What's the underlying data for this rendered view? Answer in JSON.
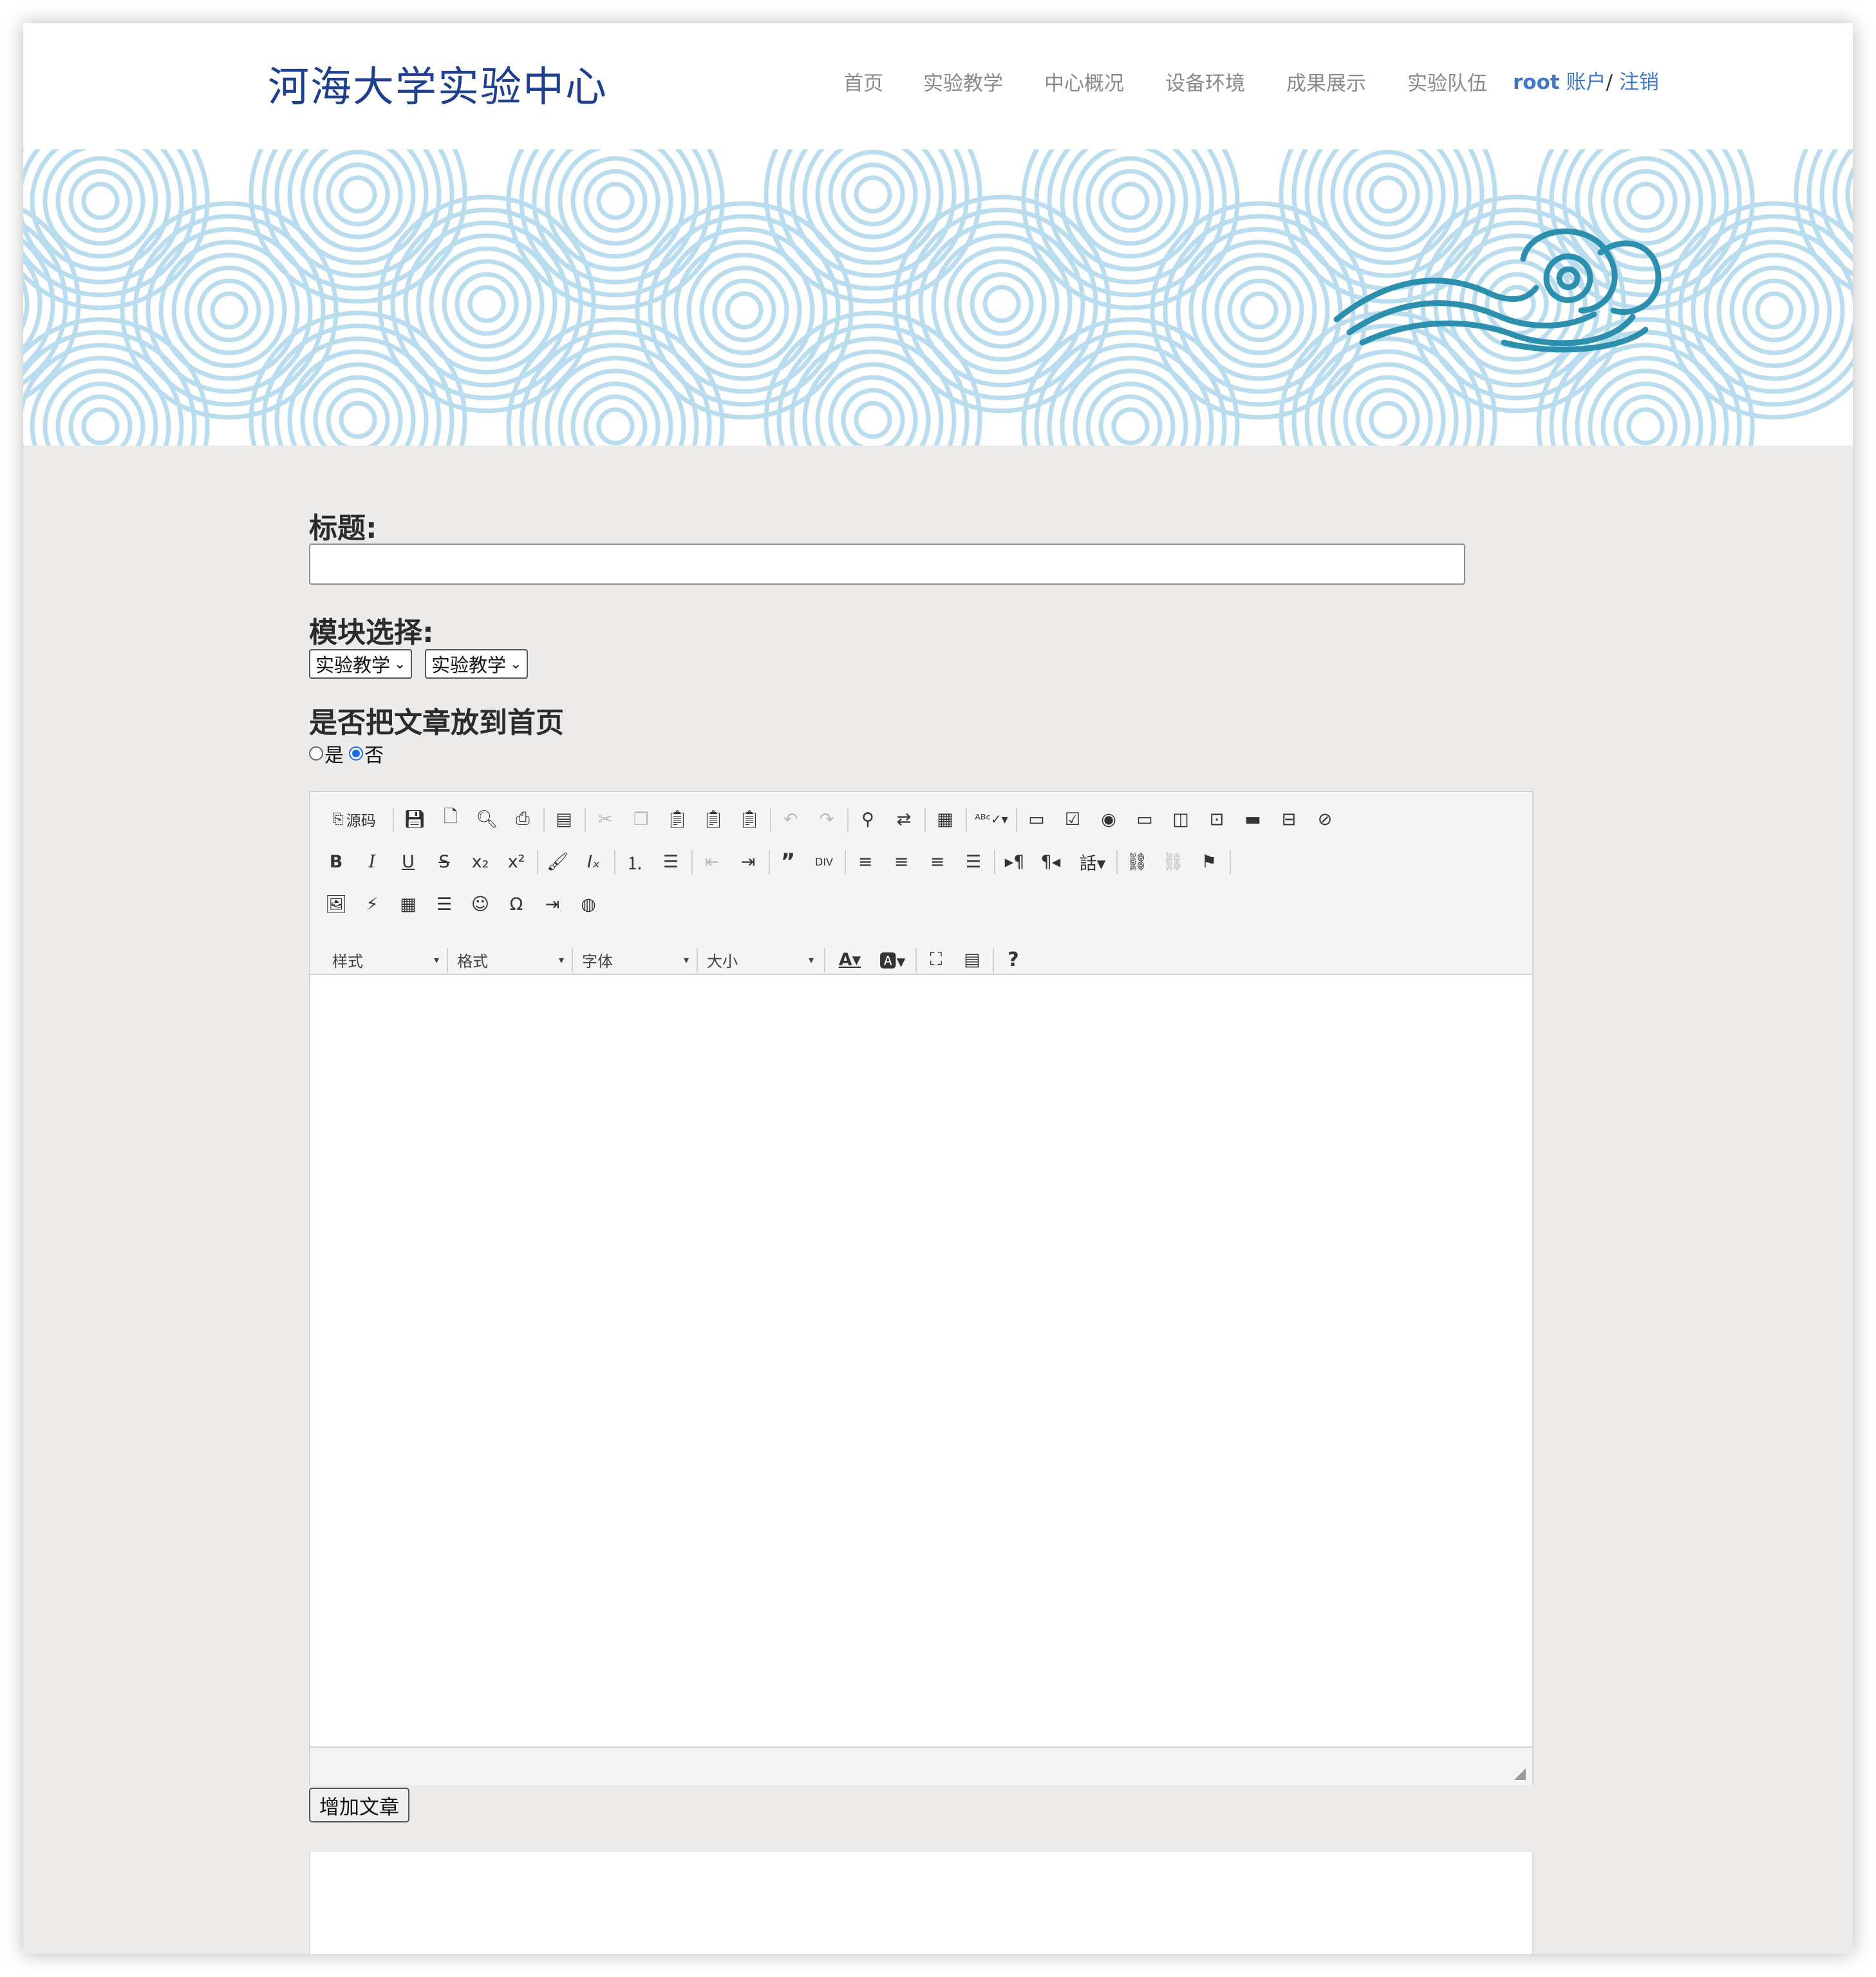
{
  "header": {
    "site_title": "河海大学实验中心",
    "nav": [
      "首页",
      "实验教学",
      "中心概况",
      "设备环境",
      "成果展示",
      "实验队伍"
    ],
    "account_user": "root",
    "account_label": "账户",
    "account_sep": "/",
    "logout_label": "注销"
  },
  "form": {
    "title_label": "标题:",
    "title_value": "",
    "module_label": "模块选择:",
    "module_select_1": "实验教学",
    "module_select_2": "实验教学",
    "homepage_question": "是否把文章放到首页",
    "radio_yes": "是",
    "radio_no": "否",
    "selected_radio": "否",
    "submit_label": "增加文章"
  },
  "editor": {
    "source_label": "源码",
    "combo_style": "样式",
    "combo_format": "格式",
    "combo_font": "字体",
    "combo_size": "大小",
    "help_label": "?",
    "content": ""
  },
  "colors": {
    "title_blue": "#1e3f8f",
    "account_blue": "#3f78c8",
    "page_bg": "#ecebe9",
    "wave_light": "#b9dcee",
    "cloud_teal": "#2b8fad"
  }
}
